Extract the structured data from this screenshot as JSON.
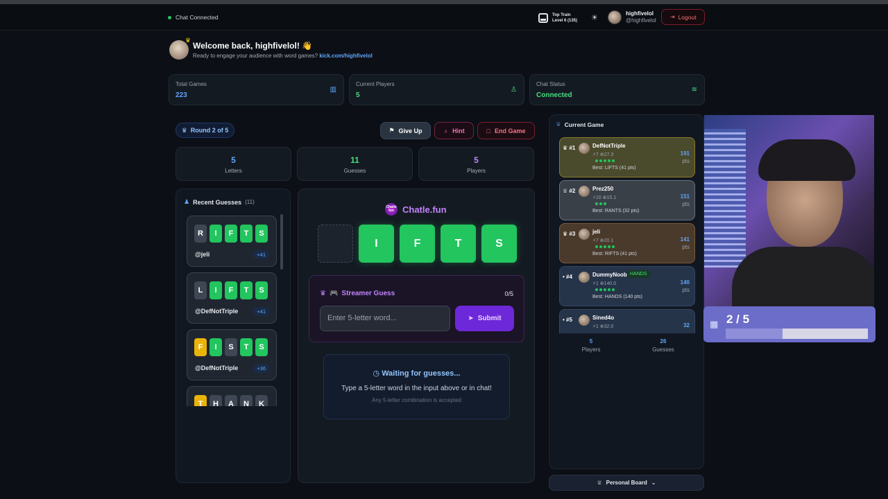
{
  "topbar": {
    "chat_status": "Chat Connected",
    "train_title": "Top Train",
    "train_level": "Level 6 (135)",
    "username": "highfivelol",
    "handle": "@highfivelol",
    "logout": "Logout"
  },
  "welcome": {
    "title": "Welcome back, highfivelol! 👋",
    "subtitle": "Ready to engage your audience with word games?",
    "link": "kick.com/highfivelol"
  },
  "stats": [
    {
      "label": "Total Games",
      "value": "223",
      "color": "#60a5fa"
    },
    {
      "label": "Current Players",
      "value": "5",
      "color": "#4ade80"
    },
    {
      "label": "Chat Status",
      "value": "Connected",
      "color": "#4ade80"
    }
  ],
  "controls": {
    "round": "Round 2 of 5",
    "give_up": "Give Up",
    "hint": "Hint",
    "end_game": "End Game"
  },
  "mini_stats": [
    {
      "value": "5",
      "label": "Letters",
      "color": "#60a5fa"
    },
    {
      "value": "11",
      "label": "Guesses",
      "color": "#4ade80"
    },
    {
      "value": "5",
      "label": "Players",
      "color": "#c084fc"
    }
  ],
  "recent": {
    "title": "Recent Guesses",
    "count": "(11)",
    "guesses": [
      {
        "letters": [
          "R",
          "I",
          "F",
          "T",
          "S"
        ],
        "states": [
          "x",
          "g",
          "g",
          "g",
          "g"
        ],
        "user": "@jeli",
        "pts": "+41"
      },
      {
        "letters": [
          "L",
          "I",
          "F",
          "T",
          "S"
        ],
        "states": [
          "x",
          "g",
          "g",
          "g",
          "g"
        ],
        "user": "@DefNotTriple",
        "pts": "+41"
      },
      {
        "letters": [
          "F",
          "I",
          "S",
          "T",
          "S"
        ],
        "states": [
          "y",
          "g",
          "x",
          "g",
          "g"
        ],
        "user": "@DefNotTriple",
        "pts": "+36"
      },
      {
        "letters": [
          "T",
          "H",
          "A",
          "N",
          "K"
        ],
        "states": [
          "y",
          "x",
          "x",
          "x",
          "x"
        ],
        "user": "",
        "pts": ""
      }
    ]
  },
  "board": {
    "brand": "Chatle.fun",
    "brand_icon": "Chatle fun",
    "tiles": [
      "",
      "I",
      "F",
      "T",
      "S"
    ]
  },
  "streamer": {
    "title": "Streamer Guess",
    "count": "0/5",
    "placeholder": "Enter 5-letter word...",
    "submit": "Submit"
  },
  "waiting": {
    "title": "Waiting for guesses...",
    "line1": "Type a 5-letter word in the input above or in chat!",
    "line2": "Any 5-letter combination is accepted"
  },
  "current_game": {
    "title": "Current Game",
    "players": [
      {
        "rank": "#1",
        "name": "DefNotTriple",
        "tag": "",
        "meta": "⚡7 ⊕27.3",
        "dots": 5,
        "best": "Best: LIFTS (41 pts)",
        "score": "191",
        "unit": "pts",
        "bg": "#4a4a2c",
        "border": "#8a7a2a"
      },
      {
        "rank": "#2",
        "name": "Prez250",
        "tag": "",
        "meta": "⚡10 ⊕15.1",
        "dots": 3,
        "best": "Best: RANTS (32 pts)",
        "score": "151",
        "unit": "pts",
        "bg": "#3a4048",
        "border": "#6b7280"
      },
      {
        "rank": "#3",
        "name": "jeli",
        "tag": "",
        "meta": "⚡7 ⊕20.1",
        "dots": 5,
        "best": "Best: RIFTS (41 pts)",
        "score": "141",
        "unit": "pts",
        "bg": "#4a3a2c",
        "border": "#7a5a3a"
      },
      {
        "rank": "#4",
        "name": "DummyNoob",
        "tag": "HANDS",
        "meta": "⚡1 ⊕140.0",
        "dots": 5,
        "best": "Best: HANDS (140 pts)",
        "score": "140",
        "unit": "pts",
        "bg": "#263449",
        "border": "#33476a"
      },
      {
        "rank": "#5",
        "name": "Sined4o",
        "tag": "",
        "meta": "⚡1 ⊕32.0",
        "dots": 0,
        "best": "",
        "score": "32",
        "unit": "",
        "bg": "#263449",
        "border": "#33476a"
      }
    ],
    "footer_players": "5",
    "footer_players_label": "Players",
    "footer_guesses": "26",
    "footer_guesses_label": "Guesses"
  },
  "personal_board": "Personal Board",
  "goal": {
    "value": "2 / 5",
    "progress": 0.4
  }
}
